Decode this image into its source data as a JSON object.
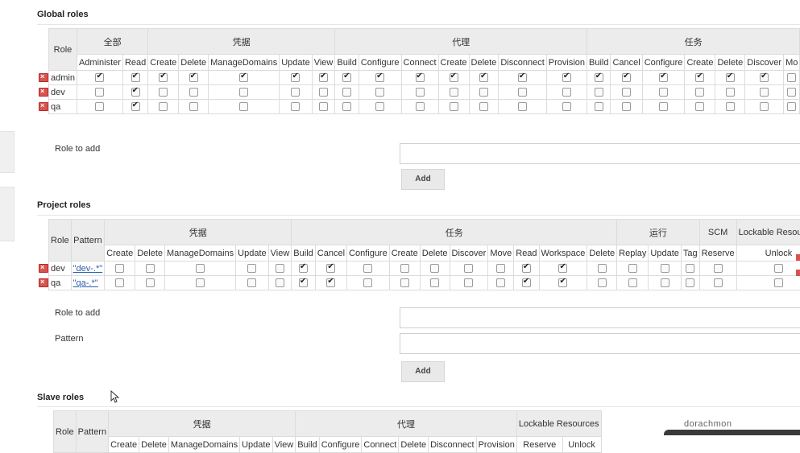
{
  "global": {
    "title": "Global roles",
    "role_header": "Role",
    "groups": [
      {
        "label": "全部",
        "span": 2
      },
      {
        "label": "凭据",
        "span": 5
      },
      {
        "label": "代理",
        "span": 7
      },
      {
        "label": "任务",
        "span": 7
      }
    ],
    "columns": [
      "Administer",
      "Read",
      "Create",
      "Delete",
      "ManageDomains",
      "Update",
      "View",
      "Build",
      "Configure",
      "Connect",
      "Create",
      "Delete",
      "Disconnect",
      "Provision",
      "Build",
      "Cancel",
      "Configure",
      "Create",
      "Delete",
      "Discover",
      "Mo"
    ],
    "rows": [
      {
        "name": "admin",
        "checks": [
          1,
          1,
          1,
          1,
          1,
          1,
          1,
          1,
          1,
          1,
          1,
          1,
          1,
          1,
          1,
          1,
          1,
          1,
          1,
          1,
          0
        ]
      },
      {
        "name": "dev",
        "checks": [
          0,
          1,
          0,
          0,
          0,
          0,
          0,
          0,
          0,
          0,
          0,
          0,
          0,
          0,
          0,
          0,
          0,
          0,
          0,
          0,
          0
        ]
      },
      {
        "name": "qa",
        "checks": [
          0,
          1,
          0,
          0,
          0,
          0,
          0,
          0,
          0,
          0,
          0,
          0,
          0,
          0,
          0,
          0,
          0,
          0,
          0,
          0,
          0
        ]
      }
    ],
    "role_to_add_label": "Role to add",
    "add_label": "Add"
  },
  "project": {
    "title": "Project roles",
    "role_header": "Role",
    "pattern_header": "Pattern",
    "groups": [
      {
        "label": "凭据",
        "span": 5
      },
      {
        "label": "任务",
        "span": 10
      },
      {
        "label": "运行",
        "span": 3
      },
      {
        "label": "SCM",
        "span": 1
      },
      {
        "label": "Lockable Resources",
        "span": 2
      }
    ],
    "columns": [
      "Create",
      "Delete",
      "ManageDomains",
      "Update",
      "View",
      "Build",
      "Cancel",
      "Configure",
      "Create",
      "Delete",
      "Discover",
      "Move",
      "Read",
      "Workspace",
      "Delete",
      "Replay",
      "Update",
      "Tag",
      "Reserve",
      "Unlock"
    ],
    "rows": [
      {
        "name": "dev",
        "pattern": "\"dev-.*\"",
        "checks": [
          0,
          0,
          0,
          0,
          0,
          1,
          1,
          0,
          0,
          0,
          0,
          0,
          1,
          1,
          0,
          0,
          0,
          0,
          0,
          0
        ]
      },
      {
        "name": "qa",
        "pattern": "\"qa-.*\"",
        "checks": [
          0,
          0,
          0,
          0,
          0,
          1,
          1,
          0,
          0,
          0,
          0,
          0,
          1,
          1,
          0,
          0,
          0,
          0,
          0,
          0
        ]
      }
    ],
    "role_to_add_label": "Role to add",
    "pattern_label": "Pattern",
    "add_label": "Add"
  },
  "slave": {
    "title": "Slave roles",
    "role_header": "Role",
    "pattern_header": "Pattern",
    "groups": [
      {
        "label": "凭据",
        "span": 5
      },
      {
        "label": "代理",
        "span": 6
      },
      {
        "label": "Lockable Resources",
        "span": 2
      }
    ],
    "columns": [
      "Create",
      "Delete",
      "ManageDomains",
      "Update",
      "View",
      "Build",
      "Configure",
      "Connect",
      "Delete",
      "Disconnect",
      "Provision",
      "Reserve",
      "Unlock"
    ]
  },
  "watermark": "dorachmon",
  "colors": {
    "delete_icon": "#d9534f",
    "link": "#2a5db0",
    "header_bg": "#ececec"
  }
}
